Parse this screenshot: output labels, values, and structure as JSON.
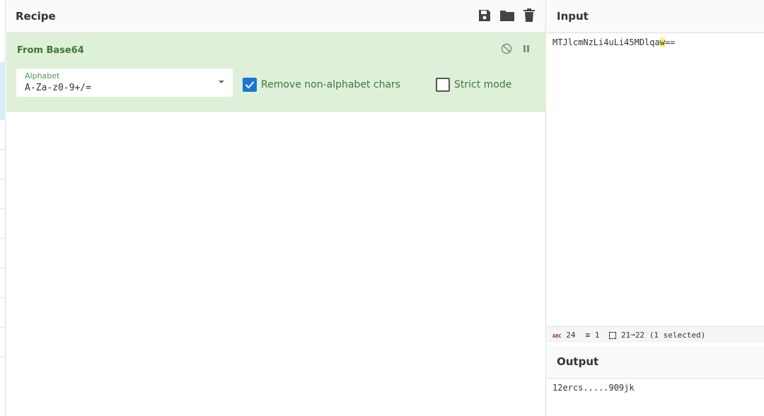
{
  "recipe": {
    "title": "Recipe"
  },
  "operation": {
    "title": "From Base64",
    "alphabet_label": "Alphabet",
    "alphabet_value": "A-Za-z0-9+/=",
    "remove_label": "Remove non-alphabet chars",
    "remove_checked": true,
    "strict_label": "Strict mode",
    "strict_checked": false
  },
  "input": {
    "title": "Input",
    "before": "MTJlcmNzLi4uLi45MDlqa",
    "selected": "w",
    "after": "=="
  },
  "status": {
    "length": "24",
    "lines": "1",
    "selection": "21➞22 (1 selected)"
  },
  "output": {
    "title": "Output",
    "value": "12ercs.....909jk"
  },
  "colors": {
    "accent": "#3c763d",
    "op_bg": "#dff0d8",
    "checkbox": "#1976d2"
  }
}
